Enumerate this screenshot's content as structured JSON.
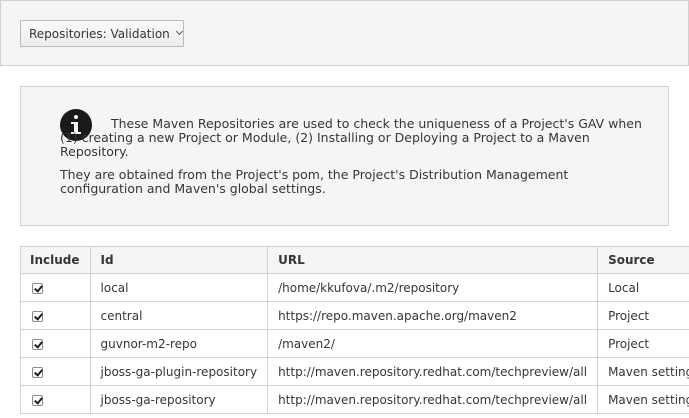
{
  "toolbar": {
    "dropdown_label": "Repositories: Validation"
  },
  "info": {
    "icon": "info-circle-icon",
    "paragraph1": "These Maven Repositories are used to check the uniqueness of a Project's GAV when (1) creating a new Project or Module, (2) Installing or Deploying a Project to a Maven Repository.",
    "paragraph2": "They are obtained from the Project's pom, the Project's Distribution Management configuration and Maven's global settings."
  },
  "table": {
    "headers": {
      "include": "Include",
      "id": "Id",
      "url": "URL",
      "source": "Source"
    },
    "rows": [
      {
        "include": true,
        "id": "local",
        "url": "/home/kkufova/.m2/repository",
        "source": "Local"
      },
      {
        "include": true,
        "id": "central",
        "url": "https://repo.maven.apache.org/maven2",
        "source": "Project"
      },
      {
        "include": true,
        "id": "guvnor-m2-repo",
        "url": "/maven2/",
        "source": "Project"
      },
      {
        "include": true,
        "id": "jboss-ga-plugin-repository",
        "url": "http://maven.repository.redhat.com/techpreview/all",
        "source": "Maven settings"
      },
      {
        "include": true,
        "id": "jboss-ga-repository",
        "url": "http://maven.repository.redhat.com/techpreview/all",
        "source": "Maven settings"
      }
    ]
  }
}
